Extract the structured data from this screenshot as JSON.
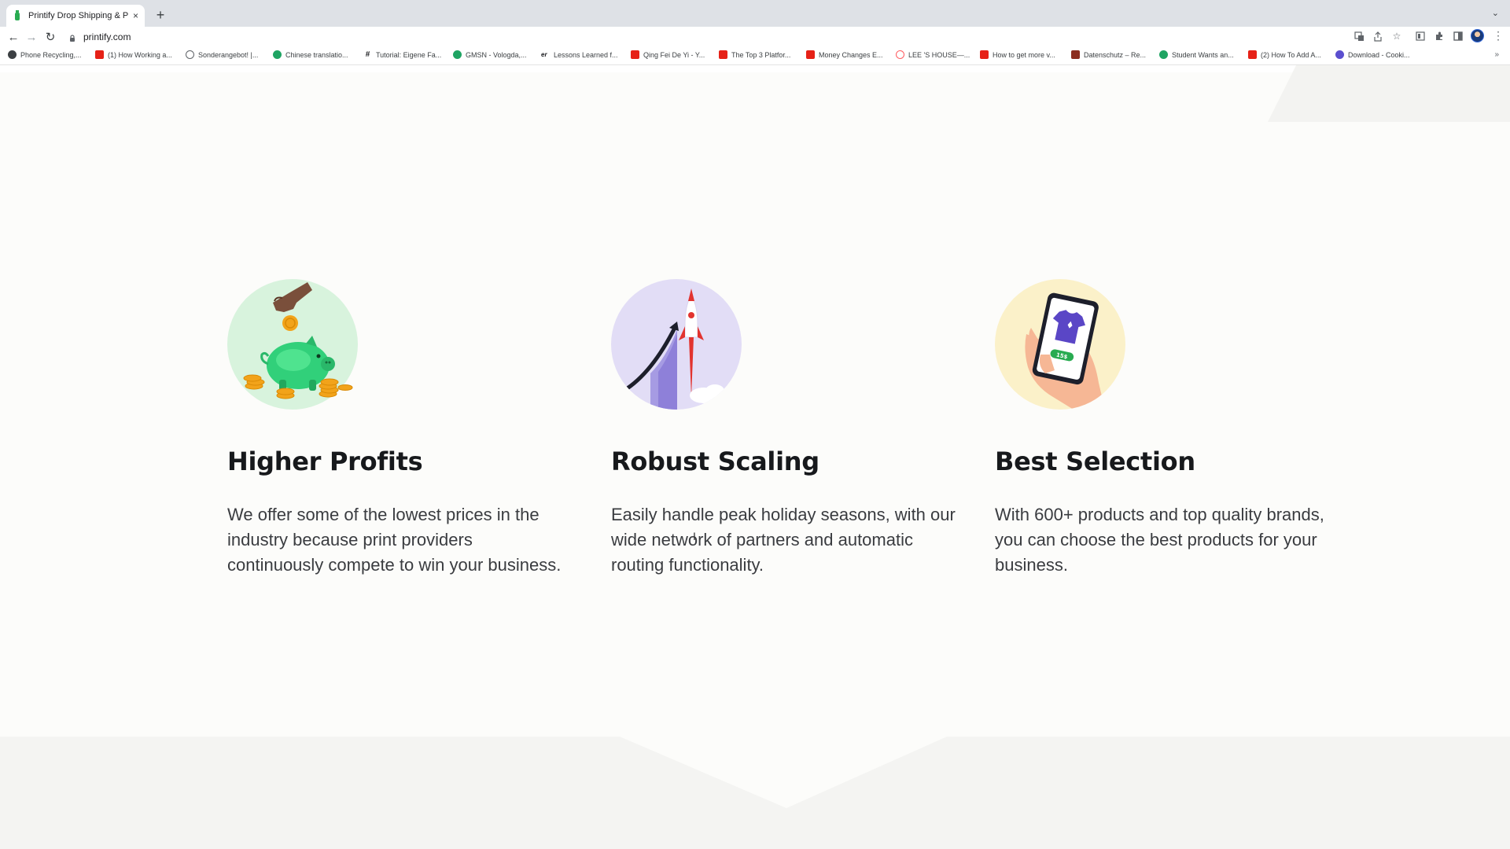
{
  "browser": {
    "tab_title": "Printify Drop Shipping & Printing",
    "tab_close": "×",
    "new_tab": "+",
    "tab_list": "⌄",
    "url": "printify.com",
    "nav": {
      "back": "←",
      "forward": "→",
      "reload": "↻"
    },
    "bookmarks": [
      {
        "label": "Phone Recycling,...",
        "color": "#3c4043"
      },
      {
        "label": "(1) How Working a...",
        "color": "#e62117"
      },
      {
        "label": "Sonderangebot! |...",
        "color": "#5f6368"
      },
      {
        "label": "Chinese translatio...",
        "color": "#1fa463"
      },
      {
        "label": "Tutorial: Eigene Fa...",
        "color": "#202124"
      },
      {
        "label": "GMSN - Vologda,...",
        "color": "#1fa463"
      },
      {
        "label": "Lessons Learned f...",
        "color": "#202124"
      },
      {
        "label": "Qing Fei De Yi - Y...",
        "color": "#e62117"
      },
      {
        "label": "The Top 3 Platfor...",
        "color": "#e62117"
      },
      {
        "label": "Money Changes E...",
        "color": "#e62117"
      },
      {
        "label": "LEE 'S HOUSE—...",
        "color": "#ff5a5f"
      },
      {
        "label": "How to get more v...",
        "color": "#e62117"
      },
      {
        "label": "Datenschutz – Re...",
        "color": "#8b2d1f"
      },
      {
        "label": "Student Wants an...",
        "color": "#1fa463"
      },
      {
        "label": "(2) How To Add A...",
        "color": "#e62117"
      },
      {
        "label": "Download - Cooki...",
        "color": "#5b4fcf"
      }
    ],
    "bookmarks_more": "»"
  },
  "features": [
    {
      "icon": "piggy-bank-icon",
      "title": "Higher Profits",
      "text": "We offer some of the lowest prices in the industry because print providers continuously compete to win your business."
    },
    {
      "icon": "rocket-growth-icon",
      "title": "Robust Scaling",
      "text": "Easily handle peak holiday seasons, with our wide network of partners and automatic routing functionality."
    },
    {
      "icon": "phone-shirt-icon",
      "title": "Best Selection",
      "text": "With 600+ products and top quality brands, you can choose the best products for your business."
    }
  ],
  "illustration_text": {
    "price_tag": "15$"
  },
  "colors": {
    "page_bg": "#fcfcfa",
    "band_bg": "#f4f4f2",
    "heading": "#17191c",
    "body_text": "#3a3c40",
    "printify_green": "#29ab51"
  }
}
